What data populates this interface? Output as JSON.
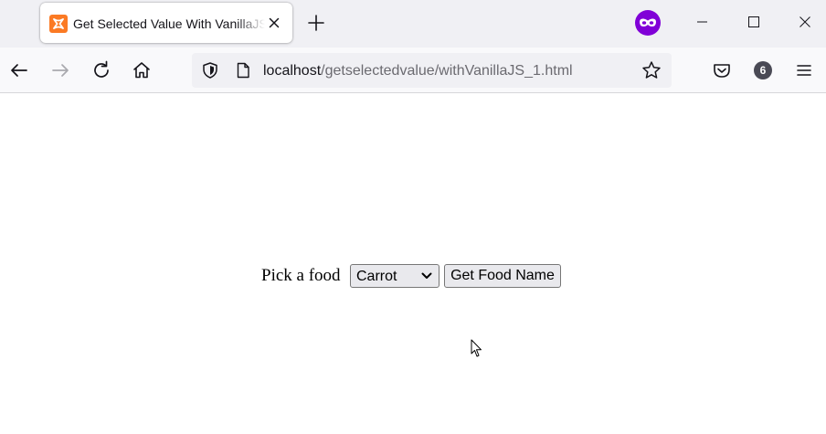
{
  "browser": {
    "tab": {
      "title": "Get Selected Value With VanillaJS",
      "favicon": "xampp-icon"
    },
    "new_tab_icon": "plus-icon",
    "private_icon": "private-browsing-mask-icon",
    "window_controls": [
      "minimize-icon",
      "maximize-icon",
      "close-icon"
    ],
    "toolbar": {
      "back_icon": "arrow-left-icon",
      "forward_icon": "arrow-right-icon",
      "reload_icon": "reload-icon",
      "home_icon": "home-icon",
      "pocket_icon": "pocket-icon",
      "extensions_badge": "6",
      "menu_icon": "hamburger-menu-icon"
    },
    "url": {
      "host": "localhost",
      "path": "/getselectedvalue/withVanillaJS_1.html",
      "shield_icon": "tracking-protection-shield-icon",
      "page_icon": "page-icon",
      "bookmark_icon": "star-icon"
    }
  },
  "page": {
    "label": "Pick a food",
    "select": {
      "selected": "Carrot"
    },
    "button_label": "Get Food Name"
  },
  "colors": {
    "tabstrip_bg": "#f0f0f4",
    "toolbar_bg": "#f9f9fb",
    "private_purple": "#8000d7",
    "favicon_orange": "#fb7a24",
    "badge_bg": "#4a4a55",
    "control_bg": "#e9e9ed"
  }
}
